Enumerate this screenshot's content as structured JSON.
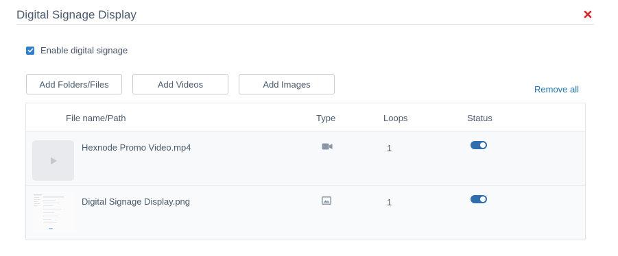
{
  "header": {
    "title": "Digital Signage Display"
  },
  "enable": {
    "label": "Enable digital signage",
    "checked": true
  },
  "actions": {
    "add_folders": "Add Folders/Files",
    "add_videos": "Add Videos",
    "add_images": "Add Images",
    "remove_all": "Remove all"
  },
  "table": {
    "columns": [
      "File name/Path",
      "Type",
      "Loops",
      "Status"
    ],
    "rows": [
      {
        "name": "Hexnode Promo Video.mp4",
        "type_icon": "video-camera-icon",
        "loops": "1",
        "status_on": true
      },
      {
        "name": "Digital Signage Display.png",
        "type_icon": "image-icon",
        "loops": "1",
        "status_on": true
      }
    ]
  },
  "colors": {
    "accent": "#2f6fb0",
    "link": "#2374b9",
    "close": "#e02424"
  }
}
